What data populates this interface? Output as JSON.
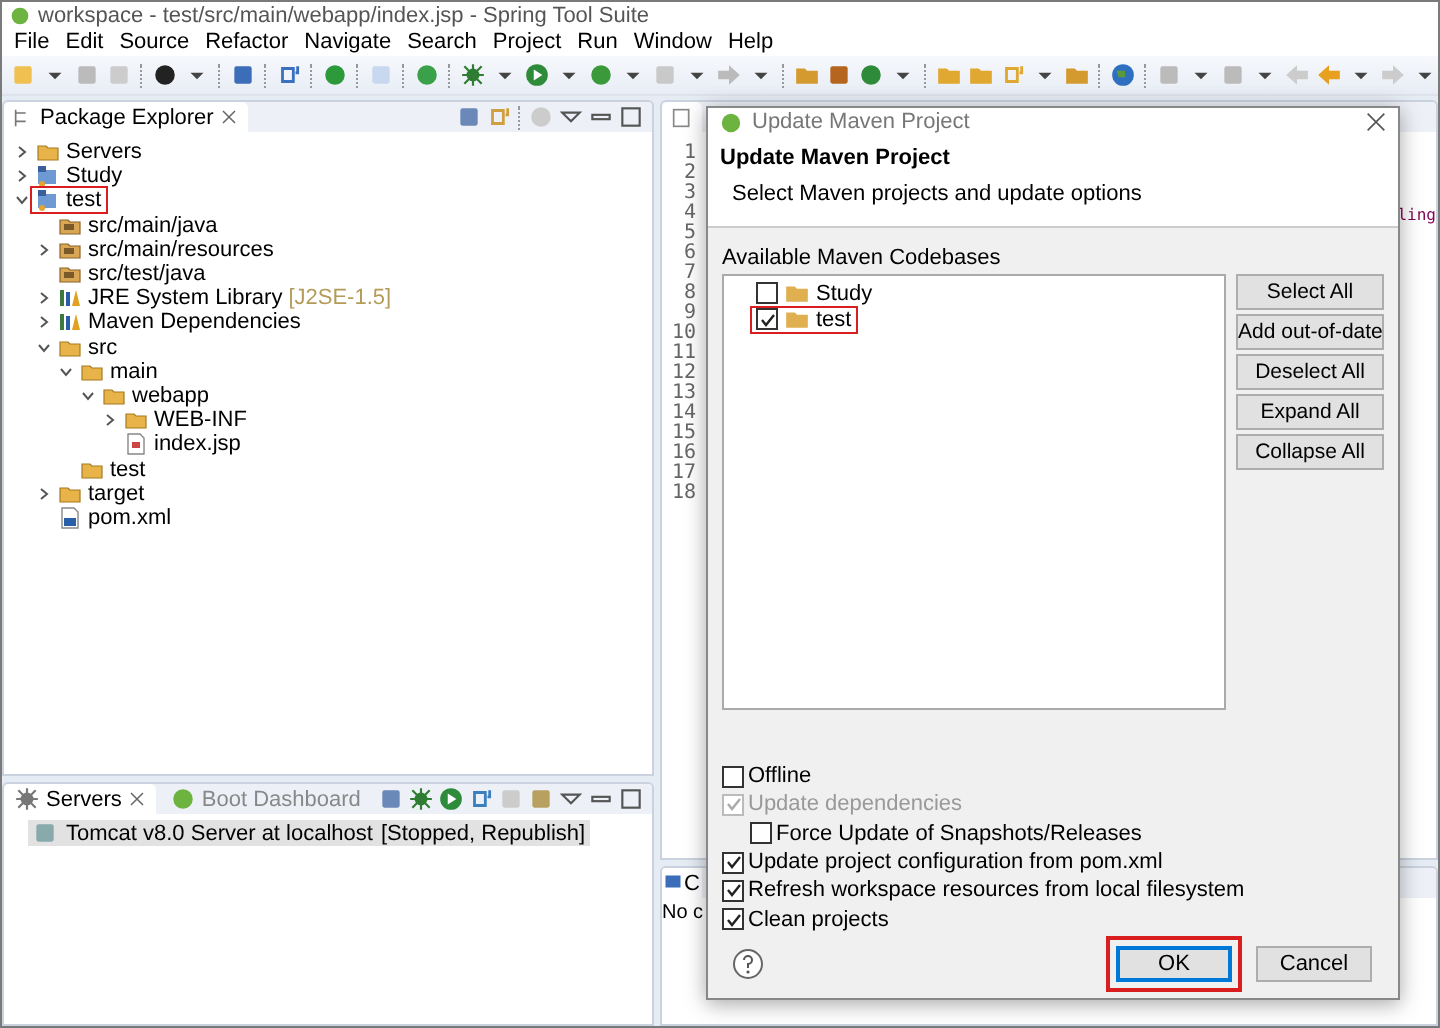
{
  "window": {
    "title": "workspace - test/src/main/webapp/index.jsp - Spring Tool Suite"
  },
  "menu": [
    "File",
    "Edit",
    "Source",
    "Refactor",
    "Navigate",
    "Search",
    "Project",
    "Run",
    "Window",
    "Help"
  ],
  "package_explorer": {
    "tab": "Package Explorer",
    "tree": [
      {
        "label": "Servers",
        "kind": "folder",
        "expanded": false
      },
      {
        "label": "Study",
        "kind": "project",
        "expanded": false
      },
      {
        "label": "test",
        "kind": "project",
        "expanded": true,
        "highlighted": true,
        "children": [
          {
            "label": "src/main/java",
            "kind": "package"
          },
          {
            "label": "src/main/resources",
            "kind": "package",
            "expanded": false
          },
          {
            "label": "src/test/java",
            "kind": "package"
          },
          {
            "label": "JRE System Library",
            "suffix": "[J2SE-1.5]",
            "kind": "library",
            "expanded": false
          },
          {
            "label": "Maven Dependencies",
            "kind": "library",
            "expanded": false
          },
          {
            "label": "src",
            "kind": "folder",
            "expanded": true,
            "children": [
              {
                "label": "main",
                "kind": "folder",
                "expanded": true,
                "children": [
                  {
                    "label": "webapp",
                    "kind": "folder",
                    "expanded": true,
                    "children": [
                      {
                        "label": "WEB-INF",
                        "kind": "folder",
                        "expanded": false
                      },
                      {
                        "label": "index.jsp",
                        "kind": "file"
                      }
                    ]
                  }
                ]
              },
              {
                "label": "test",
                "kind": "folder"
              }
            ]
          },
          {
            "label": "target",
            "kind": "folder",
            "expanded": false
          },
          {
            "label": "pom.xml",
            "kind": "maven"
          }
        ]
      }
    ]
  },
  "servers": {
    "tabs": [
      {
        "label": "Servers",
        "selected": true
      },
      {
        "label": "Boot Dashboard",
        "selected": false
      }
    ],
    "rows": [
      {
        "name": "Tomcat v8.0 Server at localhost",
        "status": "[Stopped, Republish]",
        "selected": true
      }
    ]
  },
  "editor": {
    "line_numbers": [
      "1",
      "2",
      "3",
      "4",
      "5",
      "6",
      "7",
      "8",
      "9",
      "10",
      "11",
      "12",
      "13",
      "14",
      "15",
      "16",
      "17",
      "18"
    ],
    "code_fragment": "ling"
  },
  "console": {
    "tab": "C",
    "message": "No c"
  },
  "dialog": {
    "title": "Update Maven Project",
    "heading": "Update Maven Project",
    "description": "Select Maven projects and update options",
    "list_label": "Available Maven Codebases",
    "codebases": [
      {
        "label": "Study",
        "checked": false,
        "highlighted": false
      },
      {
        "label": "test",
        "checked": true,
        "highlighted": true
      }
    ],
    "side_buttons": [
      "Select All",
      "Add out-of-date",
      "Deselect All",
      "Expand All",
      "Collapse All"
    ],
    "options": [
      {
        "label": "Offline",
        "checked": false,
        "disabled": false
      },
      {
        "label": "Update dependencies",
        "checked": true,
        "disabled": true,
        "children": [
          {
            "label": "Force Update of Snapshots/Releases",
            "checked": false,
            "disabled": false
          }
        ]
      },
      {
        "label": "Update project configuration from pom.xml",
        "checked": true,
        "disabled": false
      },
      {
        "label": "Refresh workspace resources from local filesystem",
        "checked": true,
        "disabled": false
      },
      {
        "label": "Clean projects",
        "checked": true,
        "disabled": false
      }
    ],
    "buttons": [
      {
        "label": "OK",
        "default": true,
        "highlighted": true
      },
      {
        "label": "Cancel",
        "default": false,
        "highlighted": false
      }
    ]
  }
}
